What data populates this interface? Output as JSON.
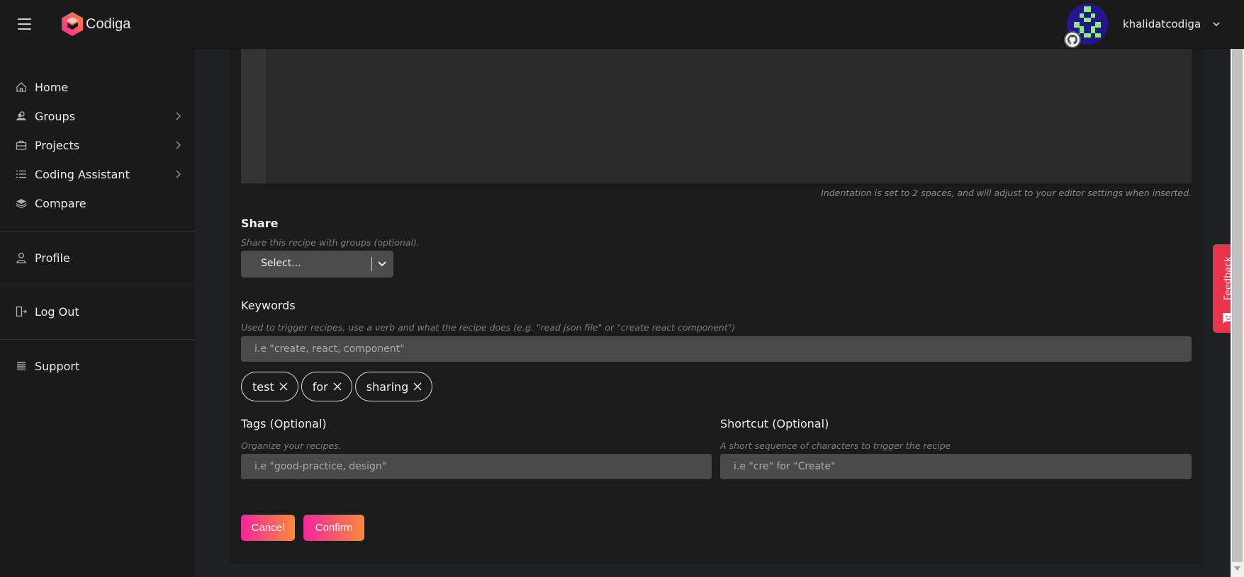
{
  "app": {
    "brand": "Codiga",
    "colors": {
      "accent_start": "#f5259c",
      "accent_end": "#f78a3a",
      "feedback": "#e8334b",
      "background": "#1a1a1a"
    }
  },
  "header": {
    "menu_icon": "hamburger-icon",
    "logo_icon": "codiga-logo",
    "username": "khalidatcodiga",
    "avatar_badge_icon": "github-icon",
    "dropdown_icon": "chevron-down-icon"
  },
  "sidebar": {
    "items": [
      {
        "label": "Home",
        "icon": "home-icon",
        "has_submenu": false
      },
      {
        "label": "Groups",
        "icon": "groups-icon",
        "has_submenu": true
      },
      {
        "label": "Projects",
        "icon": "briefcase-icon",
        "has_submenu": true
      },
      {
        "label": "Coding Assistant",
        "icon": "list-icon",
        "has_submenu": true
      },
      {
        "label": "Compare",
        "icon": "layers-icon",
        "has_submenu": false
      },
      {
        "label": "Profile",
        "icon": "user-icon",
        "has_submenu": false
      },
      {
        "label": "Log Out",
        "icon": "logout-icon",
        "has_submenu": false
      },
      {
        "label": "Support",
        "icon": "support-icon",
        "has_submenu": false
      }
    ]
  },
  "editor": {
    "indentation_hint": "Indentation is set to 2 spaces, and will adjust to your editor settings when inserted."
  },
  "share": {
    "title": "Share",
    "help": "Share this recipe with groups (optional).",
    "select_value": "Select..."
  },
  "keywords": {
    "title": "Keywords",
    "help": "Used to trigger recipes, use a verb and what the recipe does (e.g. \"read json file\" or \"create react component\")",
    "placeholder": "i.e \"create, react, component\"",
    "chips": [
      "test",
      "for",
      "sharing"
    ]
  },
  "tags": {
    "title": "Tags (Optional)",
    "help": "Organize your recipes.",
    "placeholder": "i.e \"good-practice, design\""
  },
  "shortcut": {
    "title": "Shortcut (Optional)",
    "help": "A short sequence of characters to trigger the recipe",
    "placeholder": "i.e \"cre\" for \"Create\""
  },
  "actions": {
    "cancel_label": "Cancel",
    "confirm_label": "Confirm"
  },
  "feedback": {
    "label": "Feedback"
  }
}
